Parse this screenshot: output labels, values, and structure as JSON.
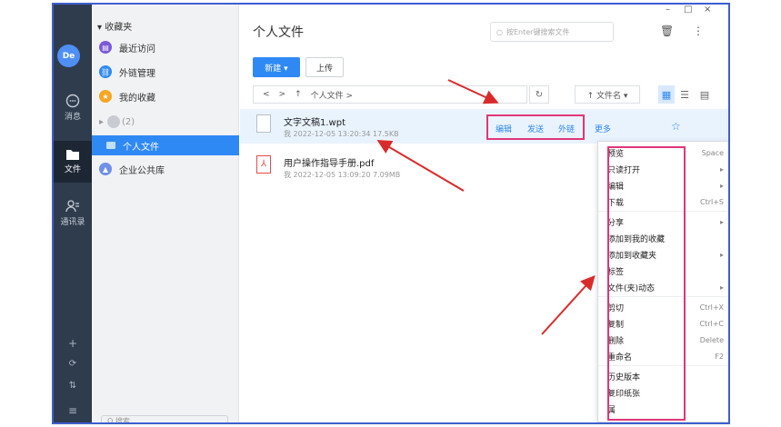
{
  "window": {
    "accent": "#2f89f5",
    "annotation_color": "#e0367a",
    "arrow_color": "#d92b2b"
  },
  "rail": {
    "avatar_text": "De",
    "items": [
      {
        "label": "消息",
        "icon": "chat-icon"
      },
      {
        "label": "文件",
        "icon": "folder-icon"
      },
      {
        "label": "通讯录",
        "icon": "contacts-icon"
      }
    ],
    "bottom_icons": [
      "plus-icon",
      "sync-icon",
      "transfer-icon",
      "menu-icon"
    ]
  },
  "panel": {
    "favorites_title": "收藏夹",
    "items": [
      {
        "label": "最近访问",
        "color": "#7b5ad8"
      },
      {
        "label": "外链管理",
        "color": "#2f89f5"
      },
      {
        "label": "我的收藏",
        "color": "#f5a623"
      }
    ],
    "group_count": "(2)",
    "selected": "个人文件",
    "enterprise": "企业公共库",
    "search_placeholder": "Q 搜索"
  },
  "main": {
    "title": "个人文件",
    "search_placeholder": "按Enter键搜索文件",
    "new_button": "新建 ▾",
    "upload_button": "上传",
    "path": [
      "<",
      ">",
      "↑",
      "个人文件 >"
    ],
    "refresh_icon": "↻",
    "sort_label": "↑ 文件名 ▾",
    "view_icons": [
      "▦",
      "☰",
      "▤"
    ],
    "window_controls": [
      "–",
      "□",
      "×"
    ]
  },
  "files": [
    {
      "name": "文字文稿1.wpt",
      "meta": "我  2022-12-05 13:20:34  17.5KB"
    },
    {
      "name": "用户操作指导手册.pdf",
      "meta": "我  2022-12-05 13:09:20  7.09MB"
    }
  ],
  "actions": {
    "edit": "编辑",
    "send": "发送",
    "external": "外链",
    "more": "更多"
  },
  "menu": {
    "items": [
      {
        "label": "预览",
        "shortcut": "Space"
      },
      {
        "label": "只读打开",
        "shortcut": "▸"
      },
      {
        "label": "编辑",
        "shortcut": "▸"
      },
      {
        "label": "下载",
        "shortcut": "Ctrl+S"
      },
      {
        "label": "分享",
        "shortcut": "▸"
      },
      {
        "label": "添加到我的收藏",
        "shortcut": ""
      },
      {
        "label": "添加到收藏夹",
        "shortcut": "▸"
      },
      {
        "label": "标签",
        "shortcut": ""
      },
      {
        "label": "文件(夹)动态",
        "shortcut": "▸"
      },
      {
        "label": "剪切",
        "shortcut": "Ctrl+X"
      },
      {
        "label": "复制",
        "shortcut": "Ctrl+C"
      },
      {
        "label": "删除",
        "shortcut": "Delete"
      },
      {
        "label": "重命名",
        "shortcut": "F2"
      },
      {
        "label": "历史版本",
        "shortcut": ""
      },
      {
        "label": "复印纸张",
        "shortcut": ""
      },
      {
        "label": "属",
        "shortcut": ""
      }
    ]
  }
}
